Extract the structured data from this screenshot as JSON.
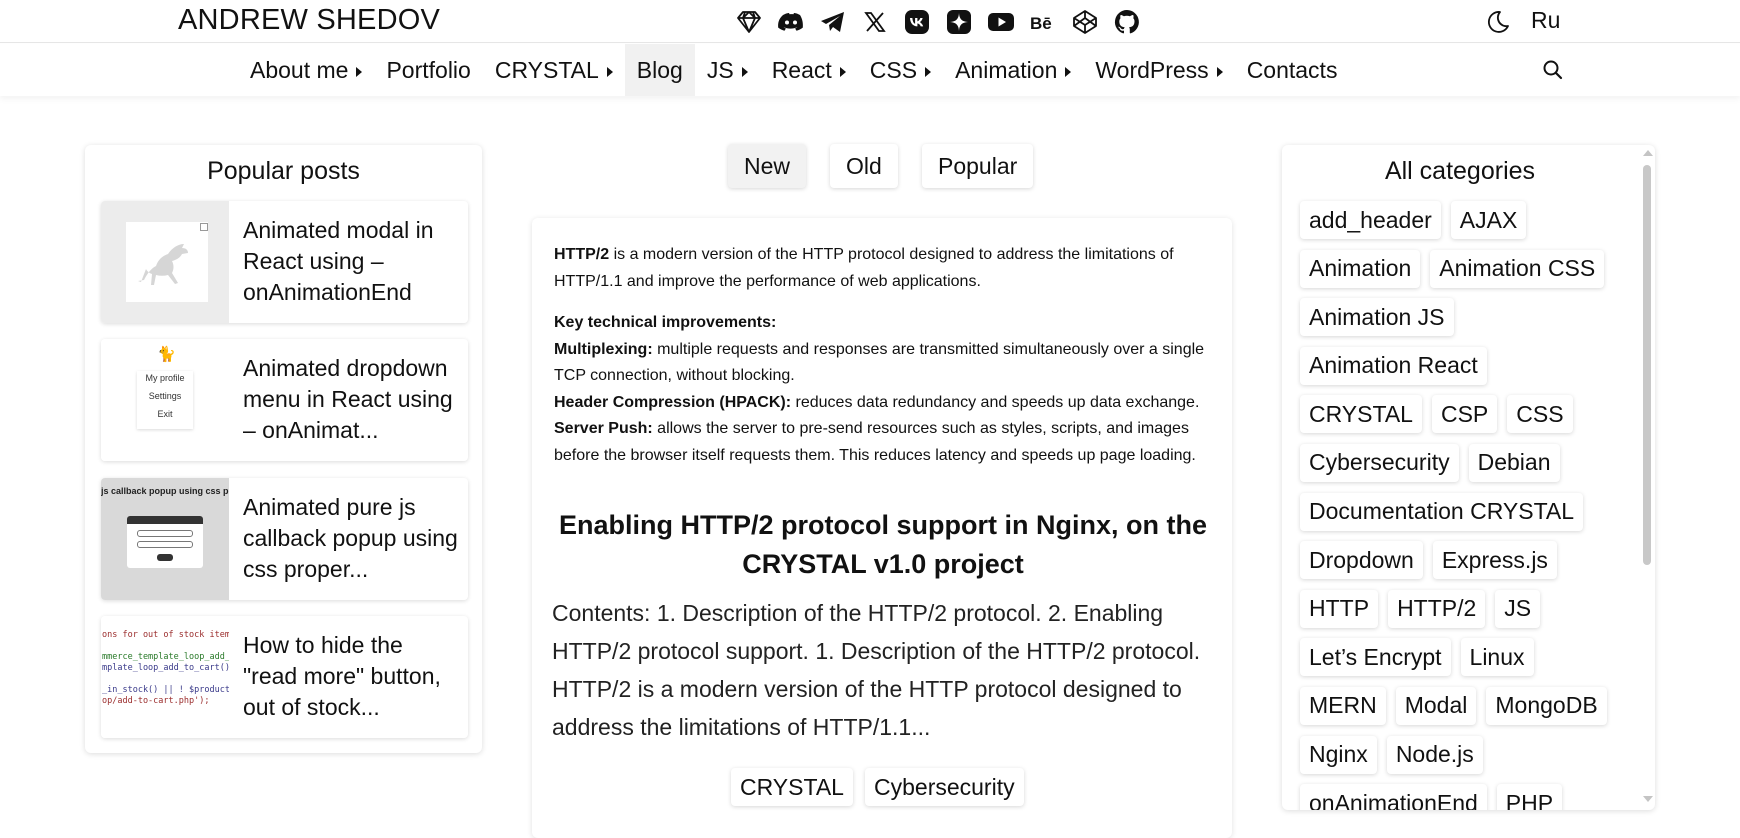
{
  "header": {
    "site_title": "ANDREW SHEDOV",
    "socials": [
      "crystal-icon",
      "discord-icon",
      "telegram-icon",
      "x-icon",
      "vk-icon",
      "yandex-zen-icon",
      "youtube-icon",
      "behance-icon",
      "codepen-icon",
      "github-icon"
    ],
    "theme_icon": "moon-icon",
    "lang": "Ru"
  },
  "nav": {
    "items": [
      {
        "label": "About me",
        "has_submenu": true
      },
      {
        "label": "Portfolio",
        "has_submenu": false
      },
      {
        "label": "CRYSTAL",
        "has_submenu": true
      },
      {
        "label": "Blog",
        "has_submenu": false,
        "active": true
      },
      {
        "label": "JS",
        "has_submenu": true
      },
      {
        "label": "React",
        "has_submenu": true
      },
      {
        "label": "CSS",
        "has_submenu": true
      },
      {
        "label": "Animation",
        "has_submenu": true
      },
      {
        "label": "WordPress",
        "has_submenu": true
      },
      {
        "label": "Contacts",
        "has_submenu": false
      }
    ],
    "search_icon": "search-icon"
  },
  "popular": {
    "title": "Popular posts",
    "posts": [
      {
        "title": "Animated modal in React using – onAnimationEnd"
      },
      {
        "title": "Animated dropdown menu in React using – onAnimat...",
        "thumb_menu": [
          "My profile",
          "Settings",
          "Exit"
        ]
      },
      {
        "title": "Animated pure js callback popup using css proper...",
        "thumb_caption": "js callback popup using css prop"
      },
      {
        "title": "How to hide the \"read more\" button, out of stock...",
        "thumb_code": [
          "ons for out of stock items",
          "",
          "mmerce_template_loop_add_t",
          "mplate_loop_add_to_cart()",
          "",
          "_in_stock() || ! $product-",
          "op/add-to-cart.php');"
        ]
      }
    ]
  },
  "sort": {
    "new": "New",
    "old": "Old",
    "popular": "Popular"
  },
  "article": {
    "p1_bold": "HTTP/2",
    "p1_rest": " is a modern version of the HTTP protocol designed to address the limitations of HTTP/1.1 and improve the performance of web applications.",
    "key_heading": "Key technical improvements:",
    "mux_bold": "Multiplexing:",
    "mux_rest": " multiple requests and responses are transmitted simultaneously over a single TCP connection, without blocking.",
    "hpack_bold": "Header Compression (HPACK):",
    "hpack_rest": " reduces data redundancy and speeds up data exchange.",
    "push_bold": "Server Push:",
    "push_rest": " allows the server to pre-send resources such as styles, scripts, and images before the browser itself requests them. This reduces latency and speeds up page loading.",
    "title": "Enabling HTTP/2 protocol support in Nginx, on the CRYSTAL v1.0 project",
    "excerpt": "Contents: 1. Description of the HTTP/2 protocol. 2. Enabling HTTP/2 protocol support. 1. Description of the HTTP/2 protocol. HTTP/2 is a modern version of the HTTP protocol designed to address the limitations of HTTP/1.1...",
    "tags": [
      "CRYSTAL",
      "Cybersecurity"
    ]
  },
  "categories": {
    "title": "All categories",
    "rows": [
      [
        "add_header",
        "AJAX"
      ],
      [
        "Animation",
        "Animation CSS"
      ],
      [
        "Animation JS"
      ],
      [
        "Animation React"
      ],
      [
        "CRYSTAL",
        "CSP",
        "CSS"
      ],
      [
        "Cybersecurity",
        "Debian"
      ],
      [
        "Documentation CRYSTAL"
      ],
      [
        "Dropdown",
        "Express.js"
      ],
      [
        "HTTP",
        "HTTP/2",
        "JS"
      ],
      [
        "Let’s Encrypt",
        "Linux"
      ],
      [
        "MERN",
        "Modal",
        "MongoDB"
      ],
      [
        "Nginx",
        "Node.js"
      ],
      [
        "onAnimationEnd",
        "PHP"
      ]
    ]
  }
}
